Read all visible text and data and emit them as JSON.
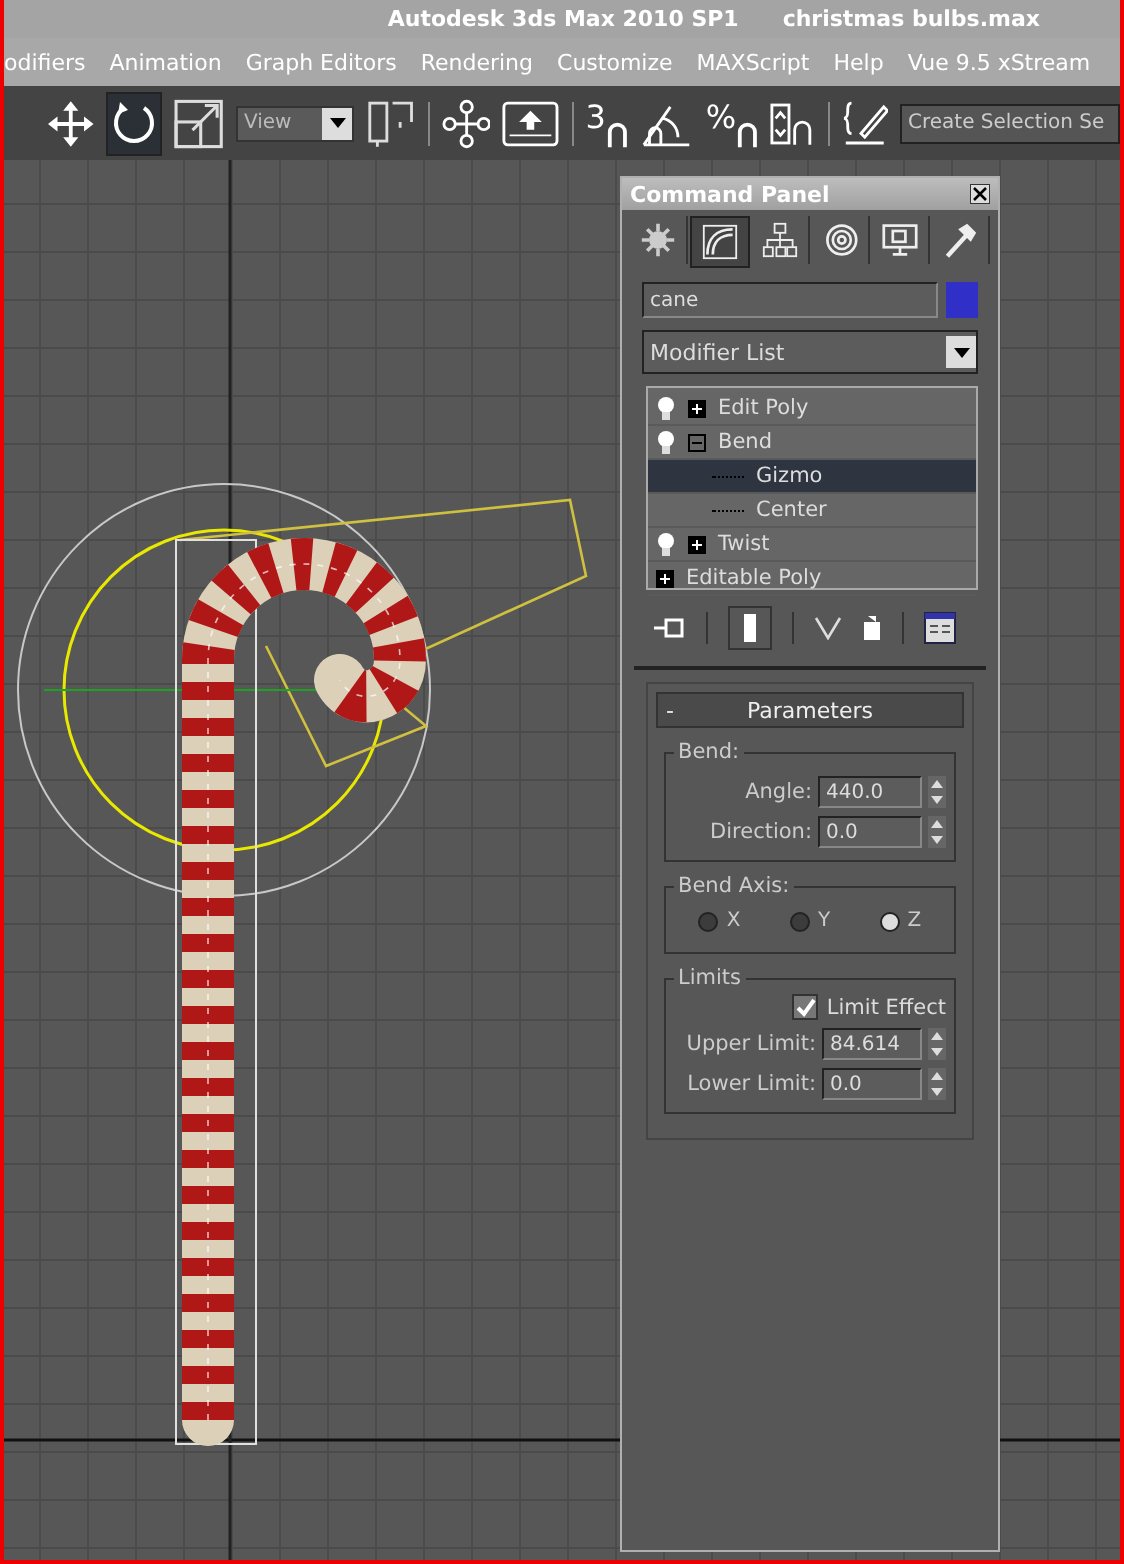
{
  "window": {
    "title": "Autodesk 3ds Max  2010 SP1",
    "file": "christmas bulbs.max"
  },
  "menu": [
    "odifiers",
    "Animation",
    "Graph Editors",
    "Rendering",
    "Customize",
    "MAXScript",
    "Help",
    "Vue 9.5 xStream"
  ],
  "toolbar": {
    "view_dropdown": "View",
    "snap_labels": [
      "3",
      "%"
    ],
    "selection_set": "Create Selection Se",
    "rotate_selected": true
  },
  "command_panel": {
    "title": "Command Panel",
    "tabs": [
      {
        "kind": "create",
        "selected": false
      },
      {
        "kind": "modify",
        "selected": true
      },
      {
        "kind": "hierarchy",
        "selected": false
      },
      {
        "kind": "motion",
        "selected": false
      },
      {
        "kind": "display",
        "selected": false
      },
      {
        "kind": "utilities",
        "selected": false
      }
    ],
    "object": {
      "name": "cane",
      "color": "#3030c8"
    },
    "modifier_list": "Modifier List",
    "stack": [
      {
        "label": "Edit Poly",
        "light": true,
        "expanded": false
      },
      {
        "label": "Bend",
        "light": true,
        "expanded": true,
        "children": [
          {
            "label": "Gizmo",
            "selected": true
          },
          {
            "label": "Center",
            "selected": false
          }
        ]
      },
      {
        "label": "Twist",
        "light": true,
        "expanded": false
      },
      {
        "label": "Editable Poly",
        "light": false,
        "expanded": false
      }
    ],
    "rollout": {
      "toggle": "-",
      "title": "Parameters",
      "bend": {
        "title": "Bend:",
        "fields": [
          {
            "label": "Angle:",
            "value": "440.0"
          },
          {
            "label": "Direction:",
            "value": "0.0"
          }
        ]
      },
      "axis": {
        "title": "Bend Axis:",
        "options": [
          {
            "label": "X",
            "selected": false
          },
          {
            "label": "Y",
            "selected": false
          },
          {
            "label": "Z",
            "selected": true
          }
        ]
      },
      "limits": {
        "title": "Limits",
        "checkbox": {
          "label": "Limit Effect",
          "checked": true
        },
        "fields": [
          {
            "label": "Upper Limit:",
            "value": "84.614"
          },
          {
            "label": "Lower Limit:",
            "value": "0.0"
          }
        ]
      }
    }
  }
}
